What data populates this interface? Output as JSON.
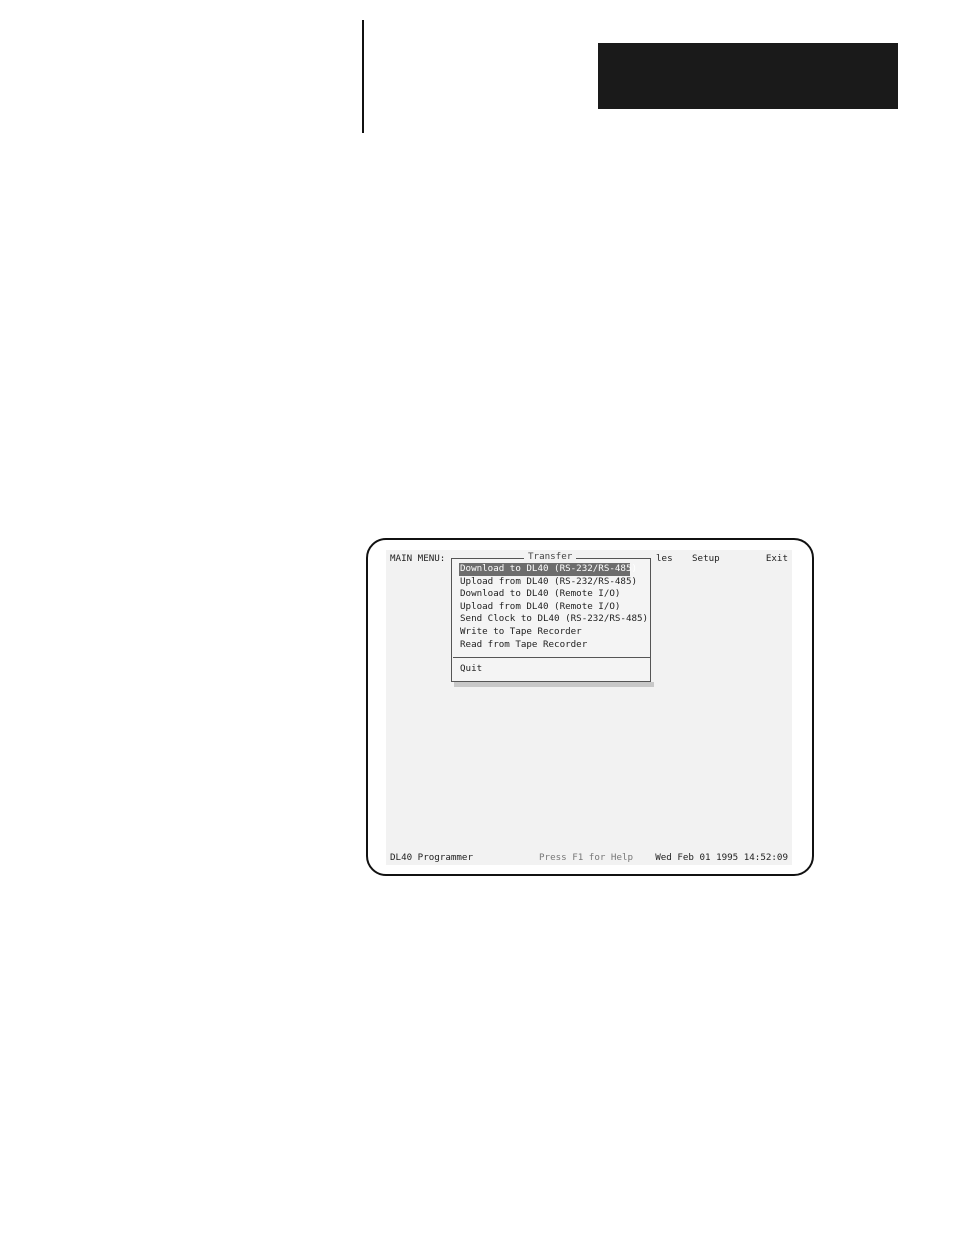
{
  "menubar": {
    "main_menu": "MAIN MENU:",
    "files_partial": "les",
    "setup": "Setup",
    "exit": "Exit"
  },
  "transfer_menu": {
    "title": "Transfer",
    "items": [
      "Download to DL40 (RS-232/RS-485)",
      "Upload from DL40 (RS-232/RS-485)",
      "Download to DL40 (Remote I/O)",
      "Upload from DL40 (Remote I/O)",
      "Send Clock to DL40 (RS-232/RS-485)",
      "Write to Tape Recorder",
      "Read from Tape Recorder"
    ],
    "selected_index": 0,
    "quit": "Quit"
  },
  "statusbar": {
    "app_name": "DL40 Programmer",
    "help_hint": "Press F1 for Help",
    "datetime": "Wed Feb 01 1995 14:52:09"
  }
}
